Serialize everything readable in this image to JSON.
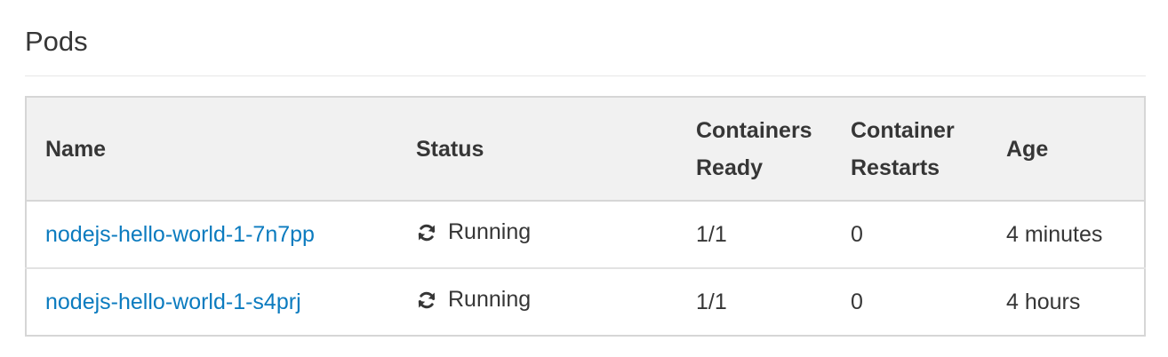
{
  "section": {
    "title": "Pods"
  },
  "table": {
    "columns": {
      "name": "Name",
      "status": "Status",
      "ready_line1": "Containers",
      "ready_line2": "Ready",
      "restarts_line1": "Container",
      "restarts_line2": "Restarts",
      "age": "Age"
    },
    "rows": [
      {
        "name": "nodejs-hello-world-1-7n7pp",
        "status": "Running",
        "status_icon": "sync-icon",
        "ready": "1/1",
        "restarts": "0",
        "age": "4 minutes"
      },
      {
        "name": "nodejs-hello-world-1-s4prj",
        "status": "Running",
        "status_icon": "sync-icon",
        "ready": "1/1",
        "restarts": "0",
        "age": "4 hours"
      }
    ]
  },
  "colors": {
    "link": "#0b7bbf",
    "header_bg": "#f1f1f1",
    "border": "#d6d6d6",
    "text": "#363636"
  }
}
